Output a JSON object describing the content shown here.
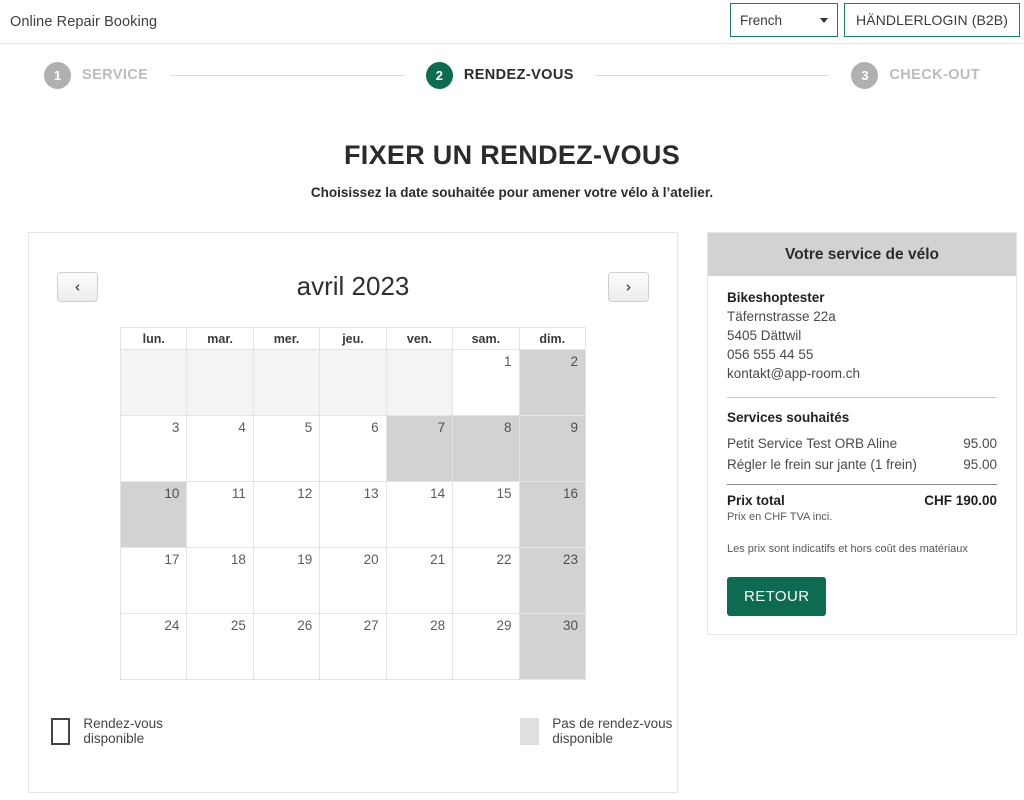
{
  "header": {
    "brand": "Online Repair Booking",
    "language_value": "French",
    "language_options": [
      "French"
    ],
    "dealer_login_label": "HÄNDLERLOGIN (B2B)",
    "accent_color": "#1a7f66"
  },
  "stepper": {
    "steps": [
      {
        "num": "1",
        "label": "SERVICE",
        "state": "inactive"
      },
      {
        "num": "2",
        "label": "RENDEZ-VOUS",
        "state": "active"
      },
      {
        "num": "3",
        "label": "CHECK-OUT",
        "state": "inactive"
      }
    ],
    "active_color": "#0d6b52",
    "inactive_color": "#b0b0b0"
  },
  "page": {
    "title": "FIXER UN RENDEZ-VOUS",
    "subtitle": "Choisissez la date souhaitée pour amener votre vélo à l’atelier."
  },
  "calendar": {
    "prev_label": "‹",
    "next_label": "›",
    "month_label": "avril 2023",
    "weekdays": [
      "lun.",
      "mar.",
      "mer.",
      "jeu.",
      "ven.",
      "sam.",
      "dim."
    ],
    "weeks": [
      [
        {
          "day": "",
          "state": "filler"
        },
        {
          "day": "",
          "state": "filler"
        },
        {
          "day": "",
          "state": "filler"
        },
        {
          "day": "",
          "state": "filler"
        },
        {
          "day": "",
          "state": "filler"
        },
        {
          "day": "1",
          "state": "available"
        },
        {
          "day": "2",
          "state": "unavailable"
        }
      ],
      [
        {
          "day": "3",
          "state": "available"
        },
        {
          "day": "4",
          "state": "available"
        },
        {
          "day": "5",
          "state": "available"
        },
        {
          "day": "6",
          "state": "available"
        },
        {
          "day": "7",
          "state": "unavailable"
        },
        {
          "day": "8",
          "state": "unavailable"
        },
        {
          "day": "9",
          "state": "unavailable"
        }
      ],
      [
        {
          "day": "10",
          "state": "unavailable"
        },
        {
          "day": "11",
          "state": "available"
        },
        {
          "day": "12",
          "state": "available"
        },
        {
          "day": "13",
          "state": "available"
        },
        {
          "day": "14",
          "state": "available"
        },
        {
          "day": "15",
          "state": "available"
        },
        {
          "day": "16",
          "state": "unavailable"
        }
      ],
      [
        {
          "day": "17",
          "state": "available"
        },
        {
          "day": "18",
          "state": "available"
        },
        {
          "day": "19",
          "state": "available"
        },
        {
          "day": "20",
          "state": "available"
        },
        {
          "day": "21",
          "state": "available"
        },
        {
          "day": "22",
          "state": "available"
        },
        {
          "day": "23",
          "state": "unavailable"
        }
      ],
      [
        {
          "day": "24",
          "state": "available"
        },
        {
          "day": "25",
          "state": "available"
        },
        {
          "day": "26",
          "state": "available"
        },
        {
          "day": "27",
          "state": "available"
        },
        {
          "day": "28",
          "state": "available"
        },
        {
          "day": "29",
          "state": "available"
        },
        {
          "day": "30",
          "state": "unavailable"
        }
      ]
    ]
  },
  "legend": {
    "available_label": "Rendez-vous disponible",
    "unavailable_label": "Pas de rendez-vous disponible",
    "available_color": "#ffffff",
    "unavailable_color": "#e0e0e0"
  },
  "sidebar": {
    "title": "Votre service de vélo",
    "shop_name": "Bikeshoptester",
    "shop_street": "Täfernstrasse 22a",
    "shop_city": "5405 Dättwil",
    "shop_phone": "056 555 44 55",
    "shop_email": "kontakt@app-room.ch",
    "services_title": "Services souhaités",
    "services": [
      {
        "name": "Petit Service Test ORB Aline",
        "price": "95.00"
      },
      {
        "name": "Régler le frein sur jante (1 frein)",
        "price": "95.00"
      }
    ],
    "total_label": "Prix total",
    "total_value": "CHF 190.00",
    "vat_note": "Prix en CHF TVA inci.",
    "disclaimer": "Les prix sont indicatifs et hors coût des matériaux",
    "back_button": "RETOUR",
    "button_color": "#0d6b52"
  }
}
